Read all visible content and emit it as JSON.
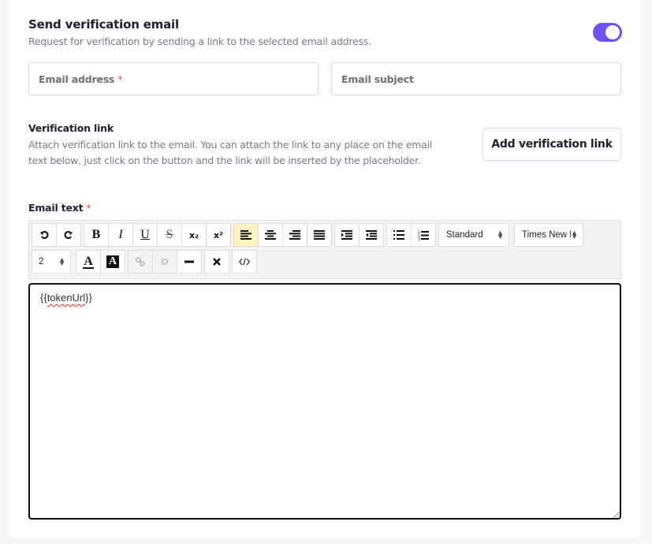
{
  "verification_email": {
    "title": "Send verification email",
    "description": "Request for verification by sending a link to the selected email address.",
    "toggle_enabled": true,
    "toggle_color": "#7050f0"
  },
  "fields": {
    "email_address": {
      "label": "Email address",
      "required_mark": "*",
      "value": ""
    },
    "email_subject": {
      "label": "Email subject",
      "value": ""
    }
  },
  "verification_link": {
    "title": "Verification link",
    "description": "Attach verification link to the email. You can attach the link to any place on the email text below, just click on the button and the link will be inserted by the placeholder.",
    "button_label": "Add verification link"
  },
  "email_text": {
    "label": "Email text",
    "required_mark": "*",
    "toolbar": {
      "undo_icon": "undo-icon",
      "redo_icon": "redo-icon",
      "bold_glyph": "B",
      "italic_glyph": "I",
      "underline_glyph": "U",
      "strike_glyph": "S",
      "subscript_glyph": "x₂",
      "superscript_glyph": "x²",
      "active_alignment": "left",
      "paragraph_style": "Standard",
      "font_family": "Times New Roman",
      "font_size": "2",
      "text_color_glyph": "A",
      "bg_color_glyph": "A",
      "active_color": "#fff4c2"
    },
    "content": "{{tokenUrl}}",
    "content_prefix": "{{",
    "content_token": "tokenUrl",
    "content_suffix": "}}"
  }
}
